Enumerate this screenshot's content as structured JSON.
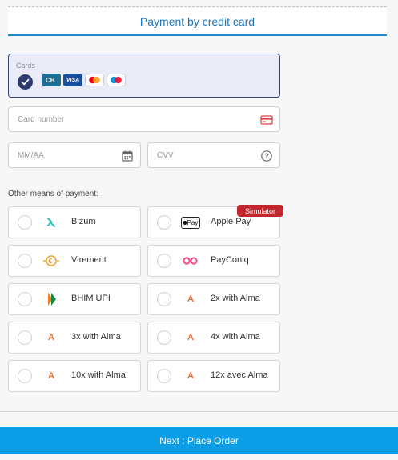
{
  "header": {
    "title": "Payment by credit card"
  },
  "cards": {
    "label": "Cards",
    "selected": true,
    "logos": [
      "cb-card-icon",
      "visa-card-icon",
      "mastercard-card-icon",
      "maestro-card-icon"
    ],
    "visa_text": "VISA"
  },
  "form": {
    "card_number_placeholder": "Card number",
    "expiry_placeholder": "MM/AA",
    "cvv_placeholder": "CVV"
  },
  "other_label": "Other means of payment:",
  "options": {
    "bizum": {
      "label": "Bizum",
      "icon": "bizum-icon"
    },
    "applepay": {
      "label": "Apple Pay",
      "icon": "apple-pay-icon",
      "logo_text": "Pay",
      "badge": "Simulator"
    },
    "virement": {
      "label": "Virement",
      "icon": "euro-transfer-icon"
    },
    "payconiq": {
      "label": "PayConiq",
      "icon": "payconiq-icon"
    },
    "bhim": {
      "label": "BHIM UPI",
      "icon": "bhim-upi-icon"
    },
    "alma2": {
      "label": "2x with Alma",
      "icon": "alma-icon",
      "logo_text": "A"
    },
    "alma3": {
      "label": "3x with Alma",
      "icon": "alma-icon",
      "logo_text": "A"
    },
    "alma4": {
      "label": "4x with Alma",
      "icon": "alma-icon",
      "logo_text": "A"
    },
    "alma10": {
      "label": "10x with Alma",
      "icon": "alma-icon",
      "logo_text": "A"
    },
    "alma12": {
      "label": "12x avec Alma",
      "icon": "alma-icon",
      "logo_text": "A"
    }
  },
  "footer": {
    "next_label": "Next : Place Order"
  },
  "colors": {
    "header_accent": "#1f8ad1",
    "selected_border": "#34437e",
    "selected_bg": "#e9ebf6",
    "button_bg": "#0b9ee6",
    "badge_bg": "#c1272d",
    "alma_orange": "#f26a2e"
  }
}
